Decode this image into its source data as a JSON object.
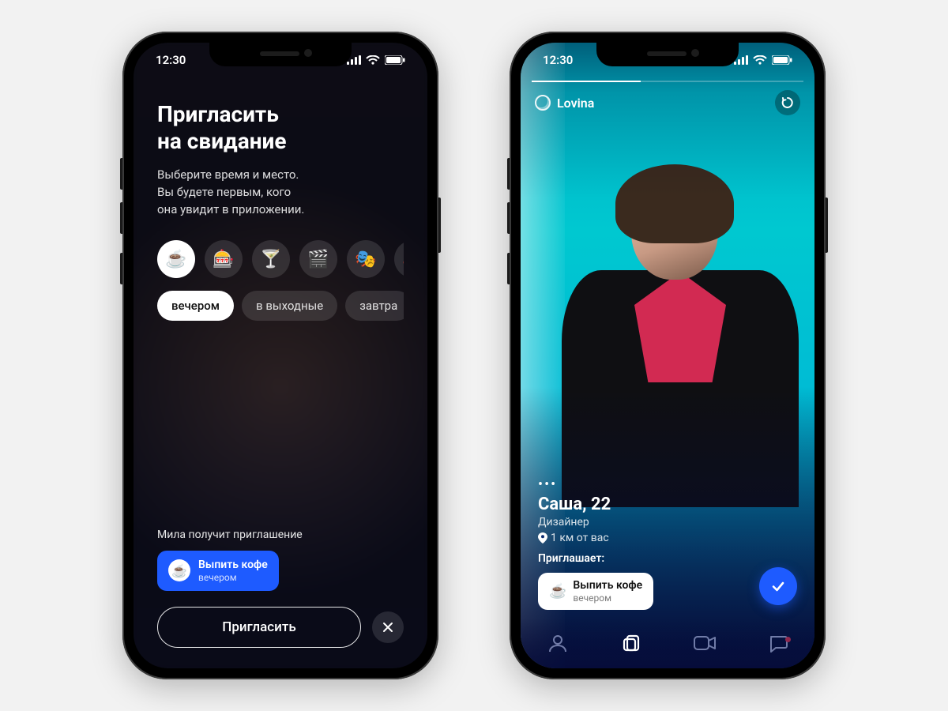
{
  "status": {
    "time": "12:30"
  },
  "invite": {
    "title_line1": "Пригласить",
    "title_line2": "на свидание",
    "subtitle": "Выберите время и место.\nВы будете первым, кого\nона увидит в приложении.",
    "activities": [
      {
        "emoji": "☕",
        "name": "coffee",
        "selected": true
      },
      {
        "emoji": "🎰",
        "name": "arcade",
        "selected": false
      },
      {
        "emoji": "🍸",
        "name": "drinks",
        "selected": false
      },
      {
        "emoji": "🎬",
        "name": "cinema",
        "selected": false
      },
      {
        "emoji": "🎭",
        "name": "theatre",
        "selected": false
      },
      {
        "emoji": "🎸",
        "name": "concert",
        "selected": false
      }
    ],
    "times": [
      {
        "label": "вечером",
        "selected": true
      },
      {
        "label": "в выходные",
        "selected": false
      },
      {
        "label": "завтра",
        "selected": false
      }
    ],
    "preview_label": "Мила получит приглашение",
    "preview": {
      "title": "Выпить кофе",
      "time": "вечером",
      "emoji": "☕"
    },
    "cta": "Пригласить"
  },
  "profile": {
    "brand": "Lovina",
    "more_symbol": "•••",
    "name_age": "Саша, 22",
    "job": "Дизайнер",
    "distance": "1 км от вас",
    "invites_label": "Приглашает:",
    "invite": {
      "title": "Выпить кофе",
      "time": "вечером",
      "emoji": "☕"
    }
  },
  "colors": {
    "accent": "#1e5bff"
  }
}
